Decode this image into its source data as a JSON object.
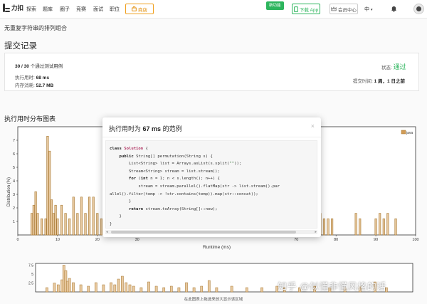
{
  "nav": {
    "brand": "力扣",
    "links": [
      "探索",
      "题库",
      "圈子",
      "竞赛",
      "面试",
      "职位"
    ],
    "store": "商店",
    "new_badge": "新功能",
    "app_button": "下载 App",
    "vip_button": "会员中心",
    "language": "中",
    "lang_caret": "▾"
  },
  "breadcrumb": "无重复字符串的排列组合",
  "section_title": "提交记录",
  "submission": {
    "passed_count": "30 / 30",
    "passed_text": "个通过测试用例",
    "runtime_label": "执行用时:",
    "runtime_value": "68 ms",
    "memory_label": "内存消耗:",
    "memory_value": "52.7 MB",
    "status_label": "状态:",
    "status_value": "通过",
    "time_label": "提交时间:",
    "time_value": "1 周，1 日之前"
  },
  "distribution_title": "执行用时分布图表",
  "modal": {
    "title_prefix": "执行用时为",
    "title_value": "67 ms",
    "title_suffix": "的范例",
    "close": "×"
  },
  "watermark": "知乎 @似懂非懂风格的话",
  "mini_caption": "在此图表上拖选来放大显示该区域",
  "colors": {
    "bar_fill": "#e8c9a0",
    "bar_stroke": "#a5762e",
    "success": "#2db55d",
    "store": "#f0a020"
  },
  "chart_data": [
    {
      "type": "bar",
      "xlabel": "Runtime (ms)",
      "ylabel": "Distribution (%)",
      "legend": "java",
      "legend_position": "top-right",
      "xlim": [
        0,
        100
      ],
      "ylim": [
        0,
        8
      ],
      "xticks": [
        0,
        10,
        20,
        30,
        70,
        80,
        90,
        100
      ],
      "yticks": [
        1,
        2,
        3,
        4,
        5,
        6,
        7
      ],
      "grid": false,
      "x": [
        3.5,
        4,
        4.5,
        5,
        6,
        7,
        7.5,
        8,
        8.5,
        9,
        9.5,
        10,
        11,
        12,
        13,
        14,
        15,
        16,
        17,
        18,
        19,
        20,
        21,
        22,
        23,
        24,
        25,
        75,
        76,
        77,
        78,
        79,
        85,
        86,
        90,
        91,
        92,
        93,
        95
      ],
      "values": [
        1.6,
        2.2,
        3.2,
        1.6,
        1.2,
        1.2,
        7.3,
        6.2,
        2.6,
        1.6,
        2.2,
        1.2,
        2.2,
        1.6,
        1.2,
        2.8,
        1.6,
        2.8,
        1.6,
        2.8,
        2.8,
        1.6,
        1.2,
        1.2,
        1.2,
        1.6,
        1.2,
        1.2,
        1.6,
        1.2,
        1.2,
        1.2,
        1.6,
        1.2,
        1.2,
        1.6,
        1.2,
        1.6,
        1.2
      ]
    },
    {
      "type": "bar",
      "xlim": [
        0,
        100
      ],
      "ylim": [
        0,
        8
      ],
      "yticks": [
        "2.5",
        "5",
        "7.5"
      ],
      "x": [
        3,
        5,
        6,
        7,
        7.5,
        8,
        8.5,
        9,
        10,
        12,
        14,
        16,
        18,
        20,
        21,
        22,
        23,
        24,
        25,
        26,
        28,
        30,
        32,
        34,
        36,
        38,
        40,
        42,
        44,
        46,
        48,
        52,
        56,
        60,
        64,
        66,
        70,
        74,
        78,
        82,
        86,
        90,
        93
      ],
      "values": [
        1.2,
        2.5,
        2,
        3.4,
        7.5,
        6,
        3,
        3.8,
        2.6,
        2,
        1.6,
        2.6,
        2,
        2.6,
        2,
        3.6,
        4.4,
        2.6,
        2,
        1.6,
        1.2,
        2.8,
        1.6,
        1.2,
        1.6,
        1.2,
        2.6,
        1.2,
        1.6,
        3.2,
        1.2,
        1.6,
        1.2,
        1.2,
        1.6,
        1.2,
        1.2,
        1.6,
        1.2,
        1.2,
        1.6,
        2.8,
        1.2
      ]
    }
  ]
}
